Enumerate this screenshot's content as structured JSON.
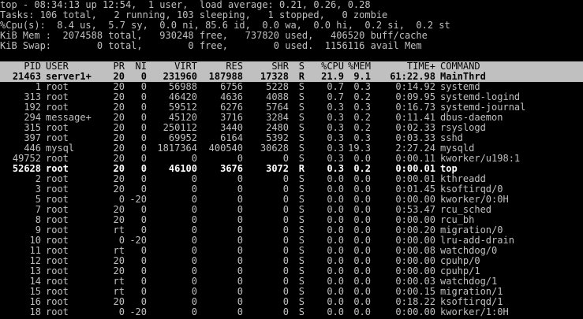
{
  "summary": {
    "line1": "top - 08:34:13 up 12:54,  1 user,  load average: 0.21, 0.26, 0.28",
    "line2": "Tasks: 106 total,   2 running, 103 sleeping,   1 stopped,   0 zombie",
    "line3": "%Cpu(s):  8.4 us,  5.7 sy,  0.0 ni, 85.6 id,  0.0 wa,  0.0 hi,  0.2 si,  0.2 st",
    "line4": "KiB Mem :  2074588 total,   930248 free,   737820 used,   406520 buff/cache",
    "line5": "KiB Swap:        0 total,        0 free,        0 used.  1156116 avail Mem"
  },
  "columns": [
    "PID",
    "USER",
    "PR",
    "NI",
    "VIRT",
    "RES",
    "SHR",
    "S",
    "%CPU",
    "%MEM",
    "TIME+",
    "COMMAND"
  ],
  "processes": [
    {
      "pid": "21463",
      "user": "server1+",
      "pr": "20",
      "ni": "0",
      "virt": "231960",
      "res": "187988",
      "shr": "17328",
      "s": "R",
      "cpu": "21.9",
      "mem": "9.1",
      "time": "61:22.98",
      "cmd": "MainThrd",
      "style": "hl"
    },
    {
      "pid": "1",
      "user": "root",
      "pr": "20",
      "ni": "0",
      "virt": "56988",
      "res": "6756",
      "shr": "5228",
      "s": "S",
      "cpu": "0.7",
      "mem": "0.3",
      "time": "0:14.92",
      "cmd": "systemd",
      "style": ""
    },
    {
      "pid": "313",
      "user": "root",
      "pr": "20",
      "ni": "0",
      "virt": "46420",
      "res": "4636",
      "shr": "4088",
      "s": "S",
      "cpu": "0.7",
      "mem": "0.2",
      "time": "0:09.95",
      "cmd": "systemd-logind",
      "style": ""
    },
    {
      "pid": "192",
      "user": "root",
      "pr": "20",
      "ni": "0",
      "virt": "59512",
      "res": "6276",
      "shr": "5764",
      "s": "S",
      "cpu": "0.3",
      "mem": "0.3",
      "time": "0:16.73",
      "cmd": "systemd-journal",
      "style": ""
    },
    {
      "pid": "294",
      "user": "message+",
      "pr": "20",
      "ni": "0",
      "virt": "45120",
      "res": "3716",
      "shr": "3284",
      "s": "S",
      "cpu": "0.3",
      "mem": "0.2",
      "time": "0:11.41",
      "cmd": "dbus-daemon",
      "style": ""
    },
    {
      "pid": "315",
      "user": "root",
      "pr": "20",
      "ni": "0",
      "virt": "250112",
      "res": "3440",
      "shr": "2480",
      "s": "S",
      "cpu": "0.3",
      "mem": "0.2",
      "time": "0:02.33",
      "cmd": "rsyslogd",
      "style": ""
    },
    {
      "pid": "397",
      "user": "root",
      "pr": "20",
      "ni": "0",
      "virt": "69952",
      "res": "6164",
      "shr": "5392",
      "s": "S",
      "cpu": "0.3",
      "mem": "0.3",
      "time": "0:03.33",
      "cmd": "sshd",
      "style": ""
    },
    {
      "pid": "446",
      "user": "mysql",
      "pr": "20",
      "ni": "0",
      "virt": "1817364",
      "res": "400540",
      "shr": "30628",
      "s": "S",
      "cpu": "0.3",
      "mem": "19.3",
      "time": "2:27.24",
      "cmd": "mysqld",
      "style": ""
    },
    {
      "pid": "49752",
      "user": "root",
      "pr": "20",
      "ni": "0",
      "virt": "0",
      "res": "0",
      "shr": "0",
      "s": "S",
      "cpu": "0.3",
      "mem": "0.0",
      "time": "0:00.11",
      "cmd": "kworker/u198:1",
      "style": ""
    },
    {
      "pid": "52628",
      "user": "root",
      "pr": "20",
      "ni": "0",
      "virt": "46100",
      "res": "3676",
      "shr": "3072",
      "s": "R",
      "cpu": "0.3",
      "mem": "0.2",
      "time": "0:00.01",
      "cmd": "top",
      "style": "bold"
    },
    {
      "pid": "2",
      "user": "root",
      "pr": "20",
      "ni": "0",
      "virt": "0",
      "res": "0",
      "shr": "0",
      "s": "S",
      "cpu": "0.0",
      "mem": "0.0",
      "time": "0:00.01",
      "cmd": "kthreadd",
      "style": ""
    },
    {
      "pid": "3",
      "user": "root",
      "pr": "20",
      "ni": "0",
      "virt": "0",
      "res": "0",
      "shr": "0",
      "s": "S",
      "cpu": "0.0",
      "mem": "0.0",
      "time": "0:01.45",
      "cmd": "ksoftirqd/0",
      "style": ""
    },
    {
      "pid": "5",
      "user": "root",
      "pr": "0",
      "ni": "-20",
      "virt": "0",
      "res": "0",
      "shr": "0",
      "s": "S",
      "cpu": "0.0",
      "mem": "0.0",
      "time": "0:00.00",
      "cmd": "kworker/0:0H",
      "style": ""
    },
    {
      "pid": "7",
      "user": "root",
      "pr": "20",
      "ni": "0",
      "virt": "0",
      "res": "0",
      "shr": "0",
      "s": "S",
      "cpu": "0.0",
      "mem": "0.0",
      "time": "0:53.47",
      "cmd": "rcu_sched",
      "style": ""
    },
    {
      "pid": "8",
      "user": "root",
      "pr": "20",
      "ni": "0",
      "virt": "0",
      "res": "0",
      "shr": "0",
      "s": "S",
      "cpu": "0.0",
      "mem": "0.0",
      "time": "0:00.00",
      "cmd": "rcu_bh",
      "style": ""
    },
    {
      "pid": "9",
      "user": "root",
      "pr": "rt",
      "ni": "0",
      "virt": "0",
      "res": "0",
      "shr": "0",
      "s": "S",
      "cpu": "0.0",
      "mem": "0.0",
      "time": "0:00.20",
      "cmd": "migration/0",
      "style": ""
    },
    {
      "pid": "10",
      "user": "root",
      "pr": "0",
      "ni": "-20",
      "virt": "0",
      "res": "0",
      "shr": "0",
      "s": "S",
      "cpu": "0.0",
      "mem": "0.0",
      "time": "0:00.00",
      "cmd": "lru-add-drain",
      "style": ""
    },
    {
      "pid": "11",
      "user": "root",
      "pr": "rt",
      "ni": "0",
      "virt": "0",
      "res": "0",
      "shr": "0",
      "s": "S",
      "cpu": "0.0",
      "mem": "0.0",
      "time": "0:00.08",
      "cmd": "watchdog/0",
      "style": ""
    },
    {
      "pid": "12",
      "user": "root",
      "pr": "20",
      "ni": "0",
      "virt": "0",
      "res": "0",
      "shr": "0",
      "s": "S",
      "cpu": "0.0",
      "mem": "0.0",
      "time": "0:00.00",
      "cmd": "cpuhp/0",
      "style": ""
    },
    {
      "pid": "13",
      "user": "root",
      "pr": "20",
      "ni": "0",
      "virt": "0",
      "res": "0",
      "shr": "0",
      "s": "S",
      "cpu": "0.0",
      "mem": "0.0",
      "time": "0:00.00",
      "cmd": "cpuhp/1",
      "style": ""
    },
    {
      "pid": "14",
      "user": "root",
      "pr": "rt",
      "ni": "0",
      "virt": "0",
      "res": "0",
      "shr": "0",
      "s": "S",
      "cpu": "0.0",
      "mem": "0.0",
      "time": "0:00.03",
      "cmd": "watchdog/1",
      "style": ""
    },
    {
      "pid": "15",
      "user": "root",
      "pr": "rt",
      "ni": "0",
      "virt": "0",
      "res": "0",
      "shr": "0",
      "s": "S",
      "cpu": "0.0",
      "mem": "0.0",
      "time": "0:00.15",
      "cmd": "migration/1",
      "style": ""
    },
    {
      "pid": "16",
      "user": "root",
      "pr": "20",
      "ni": "0",
      "virt": "0",
      "res": "0",
      "shr": "0",
      "s": "S",
      "cpu": "0.0",
      "mem": "0.0",
      "time": "0:18.22",
      "cmd": "ksoftirqd/1",
      "style": ""
    },
    {
      "pid": "18",
      "user": "root",
      "pr": "0",
      "ni": "-20",
      "virt": "0",
      "res": "0",
      "shr": "0",
      "s": "S",
      "cpu": "0.0",
      "mem": "0.0",
      "time": "0:00.00",
      "cmd": "kworker/1:0H",
      "style": ""
    }
  ],
  "colors": {
    "background": "#000000",
    "text": "#c0c0c0",
    "highlight_bg": "#c0c0c0",
    "highlight_text": "#000000",
    "bold_text": "#ffffff"
  }
}
